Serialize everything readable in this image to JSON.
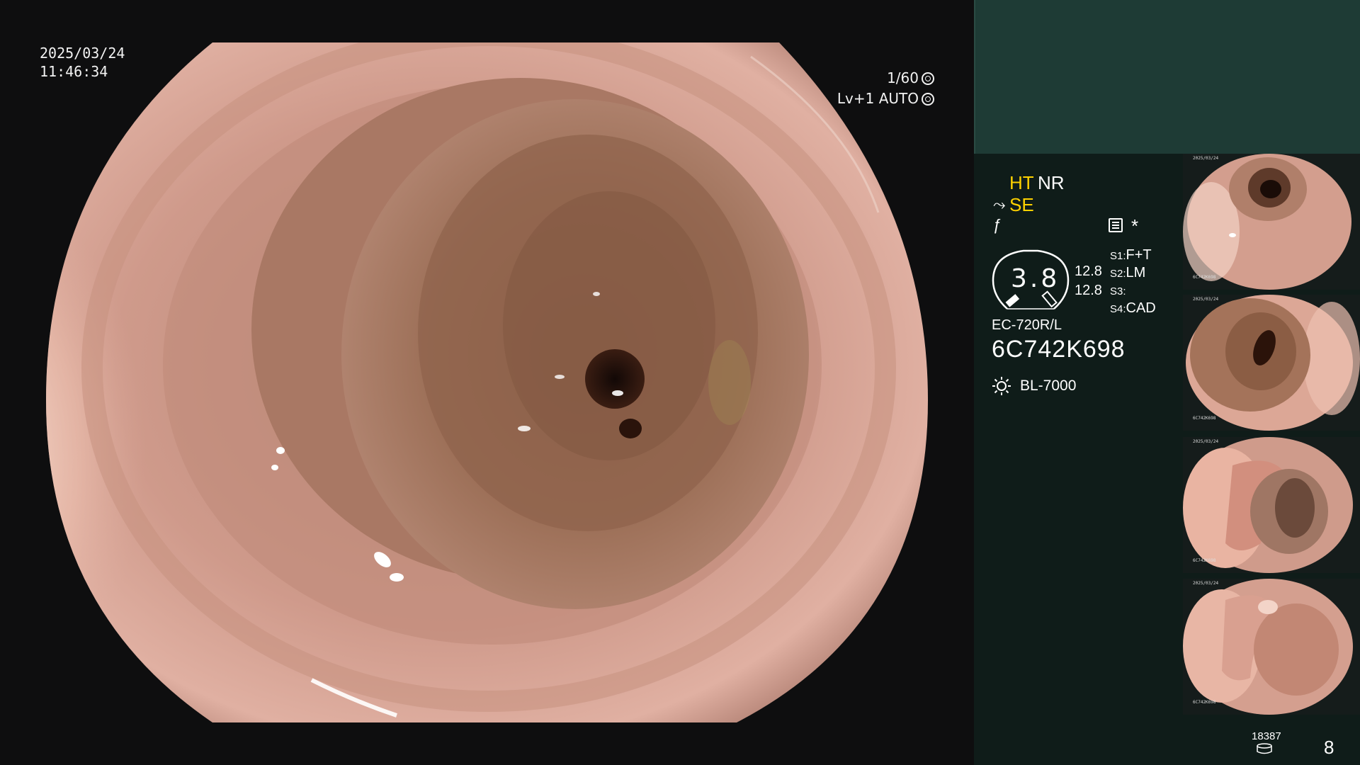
{
  "overlay": {
    "date": "2025/03/24",
    "time": "11:46:34",
    "shutter": "1/60",
    "level": "Lv+1",
    "iris": "AUTO"
  },
  "panel": {
    "mode_ht": "HT",
    "mode_nr": "NR",
    "mode_se": "SE",
    "dial_value": "3.8",
    "value_a": "12.8",
    "value_b": "12.8",
    "switches": [
      {
        "label": "S1:",
        "value": "F+T"
      },
      {
        "label": "S2:",
        "value": "LM"
      },
      {
        "label": "S3:",
        "value": ""
      },
      {
        "label": "S4:",
        "value": "CAD"
      }
    ],
    "scope_model": "EC-720R/L",
    "scope_serial": "6C742K698",
    "light_source": "BL-7000",
    "storage_count": "18387",
    "image_count": "8"
  },
  "icons": {
    "iris": "iris-icon",
    "scope_mode": "scope-mode-icon",
    "freeze": "freeze-icon",
    "menu": "menu-icon",
    "star": "star-icon",
    "light": "light-source-icon",
    "storage": "storage-icon"
  },
  "colors": {
    "panel_bg": "#0f1c19",
    "panel_top": "#1e3b35",
    "mode_highlight": "#ffd200"
  }
}
